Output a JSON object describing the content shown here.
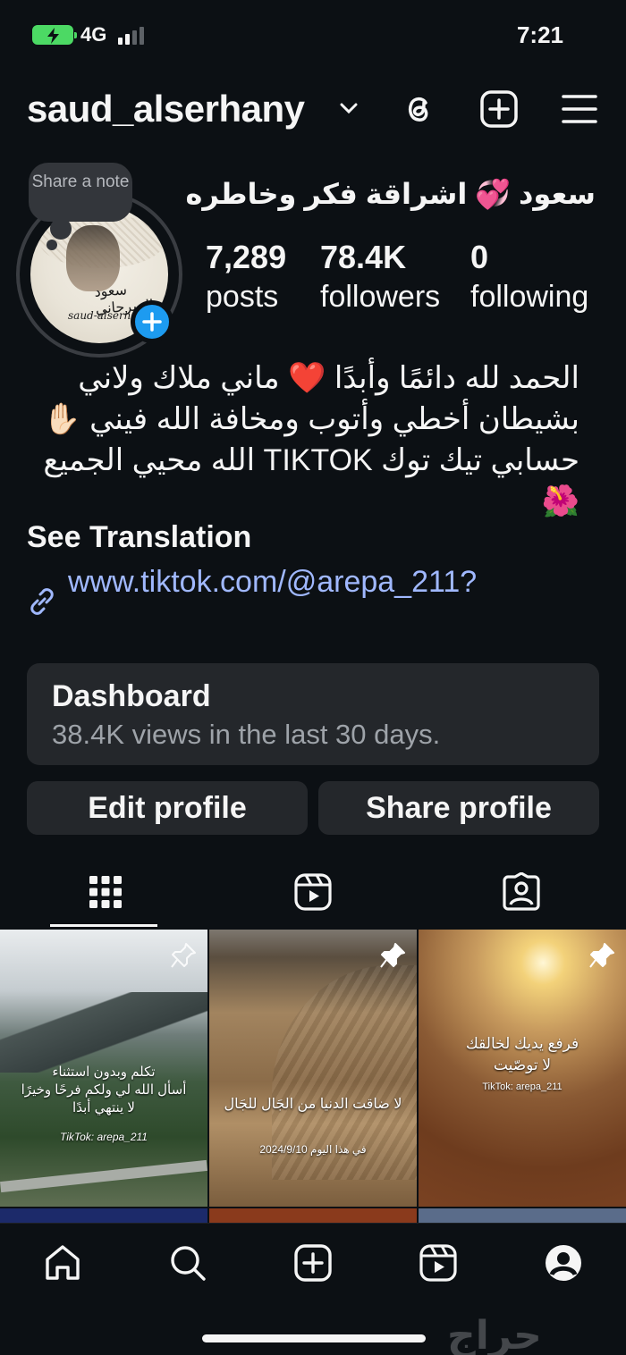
{
  "status_bar": {
    "network": "4G",
    "time": "7:21"
  },
  "header": {
    "username": "saud_alserhany"
  },
  "profile": {
    "note_text": "Share a note",
    "display_name": "سعود 💞 اشراقة فكر وخاطره",
    "avatar_sig1": "سعود السرحاني",
    "avatar_sig2": "saud-alserhany",
    "stats": [
      {
        "value": "7,289",
        "label": "posts"
      },
      {
        "value": "78.4K",
        "label": "followers"
      },
      {
        "value": "0",
        "label": "following"
      }
    ],
    "bio_lines": [
      "الحمد لله دائمًا وأبدًا ❤️ ماني ملاك ولاني",
      "بشيطان أخطي وأتوب ومخافة الله فيني ✋🏻",
      "حسابي تيك توك TIKTOK الله محيي الجميع",
      "🌺"
    ],
    "see_translation": "See Translation",
    "link": "www.tiktok.com/@arepa_211?"
  },
  "dashboard": {
    "title": "Dashboard",
    "subtitle": "38.4K views in the last 30 days."
  },
  "buttons": {
    "edit": "Edit profile",
    "share": "Share profile"
  },
  "tabs": [
    {
      "icon": "grid-icon"
    },
    {
      "icon": "reels-icon"
    },
    {
      "icon": "tagged-icon"
    }
  ],
  "posts": [
    {
      "caption": "تكلم وبدون استثناء\nأسأل الله لي ولكم فرحًا وخيرًا\nلا ينتهي أبدًا",
      "credit": "TikTok: arepa_211",
      "pinned": true
    },
    {
      "caption": "لا ضاقت الدنيا من الجَال للجَال",
      "credit": "في هذا اليوم 2024/9/10",
      "pinned": true
    },
    {
      "caption": "فرفع يديك لخالقك\nلا توصّيت",
      "credit": "TikTok: arepa_211",
      "pinned": true
    }
  ],
  "bottom_nav": [
    "home-icon",
    "search-icon",
    "create-icon",
    "reels-icon",
    "profile-icon"
  ],
  "watermark": "حراج"
}
